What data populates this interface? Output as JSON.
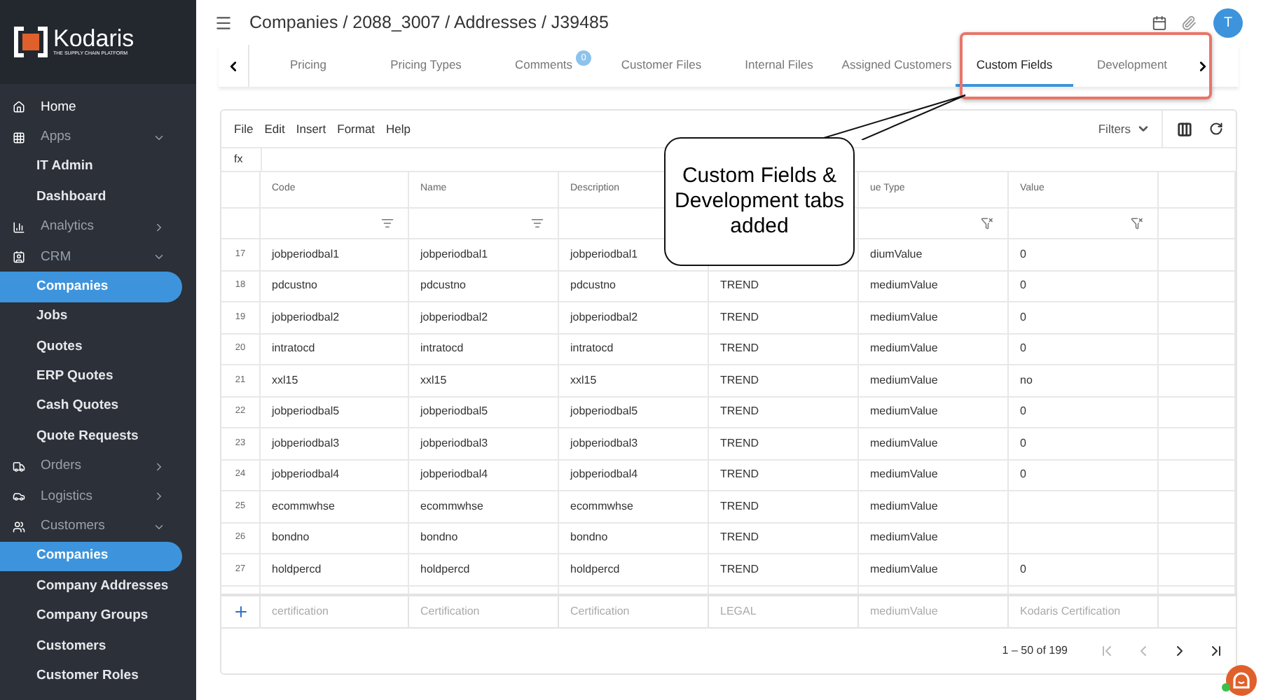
{
  "sidebar": {
    "logo": {
      "name": "Kodaris",
      "tagline": "THE SUPPLY CHAIN PLATFORM"
    },
    "items": [
      {
        "kind": "link",
        "label": "Home",
        "selected": false
      },
      {
        "kind": "section",
        "label": "Apps",
        "expanded": true,
        "children": [
          {
            "label": "IT Admin",
            "selected": false
          },
          {
            "label": "Dashboard",
            "selected": false
          }
        ]
      },
      {
        "kind": "section",
        "label": "Analytics",
        "expanded": false
      },
      {
        "kind": "section",
        "label": "CRM",
        "expanded": true,
        "children": [
          {
            "label": "Companies",
            "selected": true
          },
          {
            "label": "Jobs",
            "selected": false
          },
          {
            "label": "Quotes",
            "selected": false
          },
          {
            "label": "ERP Quotes",
            "selected": false
          },
          {
            "label": "Cash Quotes",
            "selected": false
          },
          {
            "label": "Quote Requests",
            "selected": false
          }
        ]
      },
      {
        "kind": "section",
        "label": "Orders",
        "expanded": false
      },
      {
        "kind": "section",
        "label": "Logistics",
        "expanded": false
      },
      {
        "kind": "section",
        "label": "Customers",
        "expanded": true,
        "children": [
          {
            "label": "Companies",
            "selected": true
          },
          {
            "label": "Company Addresses",
            "selected": false
          },
          {
            "label": "Company Groups",
            "selected": false
          },
          {
            "label": "Customers",
            "selected": false
          },
          {
            "label": "Customer Roles",
            "selected": false
          }
        ]
      }
    ]
  },
  "header": {
    "breadcrumb": "Companies / 2088_3007 / Addresses / J39485",
    "avatar": "T"
  },
  "tabs": [
    {
      "label": "Pricing",
      "selected": false
    },
    {
      "label": "Pricing Types",
      "selected": false
    },
    {
      "label": "Comments",
      "badge": "0",
      "selected": false
    },
    {
      "label": "Customer Files",
      "selected": false
    },
    {
      "label": "Internal Files",
      "selected": false
    },
    {
      "label": "Assigned Customers",
      "selected": false
    },
    {
      "label": "Custom Fields",
      "selected": true
    },
    {
      "label": "Development",
      "selected": false
    }
  ],
  "callout": {
    "text": "Custom Fields & Development tabs added"
  },
  "sheet": {
    "menu": [
      "File",
      "Edit",
      "Insert",
      "Format",
      "Help"
    ],
    "filters": "Filters",
    "formula_label": "fx",
    "columns": [
      {
        "label": "Code"
      },
      {
        "label": "Name"
      },
      {
        "label": "Description"
      },
      {},
      {
        "label": "ue Type"
      },
      {
        "label": "Value"
      }
    ],
    "rows": [
      {
        "number": "17",
        "cells": [
          "jobperiodbal1",
          "jobperiodbal1",
          "jobperiodbal1",
          null,
          "diumValue",
          "0"
        ]
      },
      {
        "number": "18",
        "cells": [
          "pdcustno",
          "pdcustno",
          "pdcustno",
          "TREND",
          "mediumValue",
          "0"
        ]
      },
      {
        "number": "19",
        "cells": [
          "jobperiodbal2",
          "jobperiodbal2",
          "jobperiodbal2",
          "TREND",
          "mediumValue",
          "0"
        ]
      },
      {
        "number": "20",
        "cells": [
          "intratocd",
          "intratocd",
          "intratocd",
          "TREND",
          "mediumValue",
          "0"
        ]
      },
      {
        "number": "21",
        "cells": [
          "xxl15",
          "xxl15",
          "xxl15",
          "TREND",
          "mediumValue",
          "no"
        ]
      },
      {
        "number": "22",
        "cells": [
          "jobperiodbal5",
          "jobperiodbal5",
          "jobperiodbal5",
          "TREND",
          "mediumValue",
          "0"
        ]
      },
      {
        "number": "23",
        "cells": [
          "jobperiodbal3",
          "jobperiodbal3",
          "jobperiodbal3",
          "TREND",
          "mediumValue",
          "0"
        ]
      },
      {
        "number": "24",
        "cells": [
          "jobperiodbal4",
          "jobperiodbal4",
          "jobperiodbal4",
          "TREND",
          "mediumValue",
          "0"
        ]
      },
      {
        "number": "25",
        "cells": [
          "ecommwhse",
          "ecommwhse",
          "ecommwhse",
          "TREND",
          "mediumValue",
          null
        ]
      },
      {
        "number": "26",
        "cells": [
          "bondno",
          "bondno",
          "bondno",
          "TREND",
          "mediumValue",
          null
        ]
      },
      {
        "number": "27",
        "cells": [
          "holdpercd",
          "holdpercd",
          "holdpercd",
          "TREND",
          "mediumValue",
          "0"
        ]
      }
    ],
    "new_row": [
      "certification",
      "Certification",
      "Certification",
      "LEGAL",
      "mediumValue",
      "Kodaris Certification"
    ],
    "pagination": "1 – 50 of 199"
  }
}
